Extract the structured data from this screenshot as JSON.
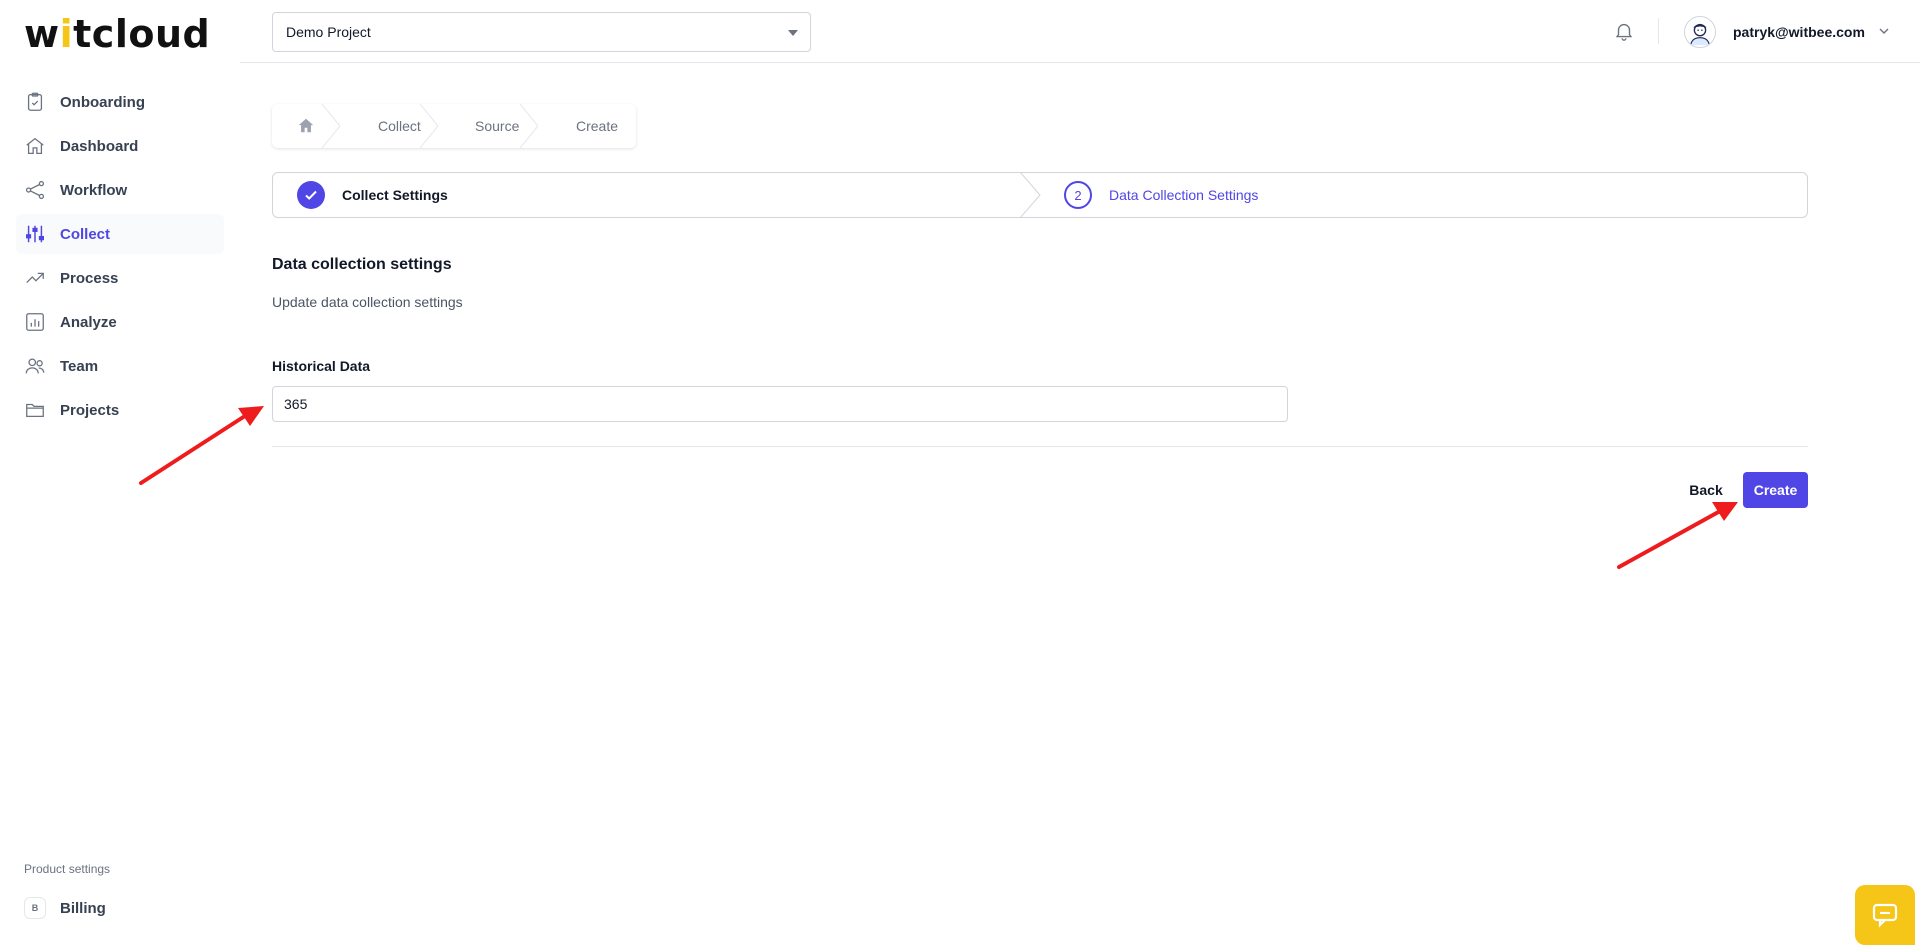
{
  "brand": {
    "logo_text_a": "w",
    "logo_text_i": "i",
    "logo_text_b": "tcloud"
  },
  "sidebar": {
    "items": [
      {
        "label": "Onboarding",
        "icon": "clipboard-icon"
      },
      {
        "label": "Dashboard",
        "icon": "home-icon"
      },
      {
        "label": "Workflow",
        "icon": "share-icon"
      },
      {
        "label": "Collect",
        "icon": "sliders-icon",
        "active": true
      },
      {
        "label": "Process",
        "icon": "trend-icon"
      },
      {
        "label": "Analyze",
        "icon": "bar-chart-icon"
      },
      {
        "label": "Team",
        "icon": "users-icon"
      },
      {
        "label": "Projects",
        "icon": "folder-icon"
      }
    ],
    "product_settings_label": "Product settings",
    "billing": {
      "badge": "B",
      "label": "Billing"
    }
  },
  "header": {
    "project_select_value": "Demo Project",
    "user_email": "patryk@witbee.com"
  },
  "breadcrumb": {
    "items": [
      "Collect",
      "Source",
      "Create"
    ]
  },
  "steps": {
    "step1_label": "Collect Settings",
    "step2_number": "2",
    "step2_label": "Data Collection Settings"
  },
  "form": {
    "title": "Data collection settings",
    "subtitle": "Update data collection settings",
    "historical_label": "Historical Data",
    "historical_value": "365"
  },
  "actions": {
    "back_label": "Back",
    "create_label": "Create"
  },
  "colors": {
    "accent": "#4f46e5",
    "brand_yellow": "#f5c518",
    "annotation_arrow": "#ee1c1c"
  }
}
